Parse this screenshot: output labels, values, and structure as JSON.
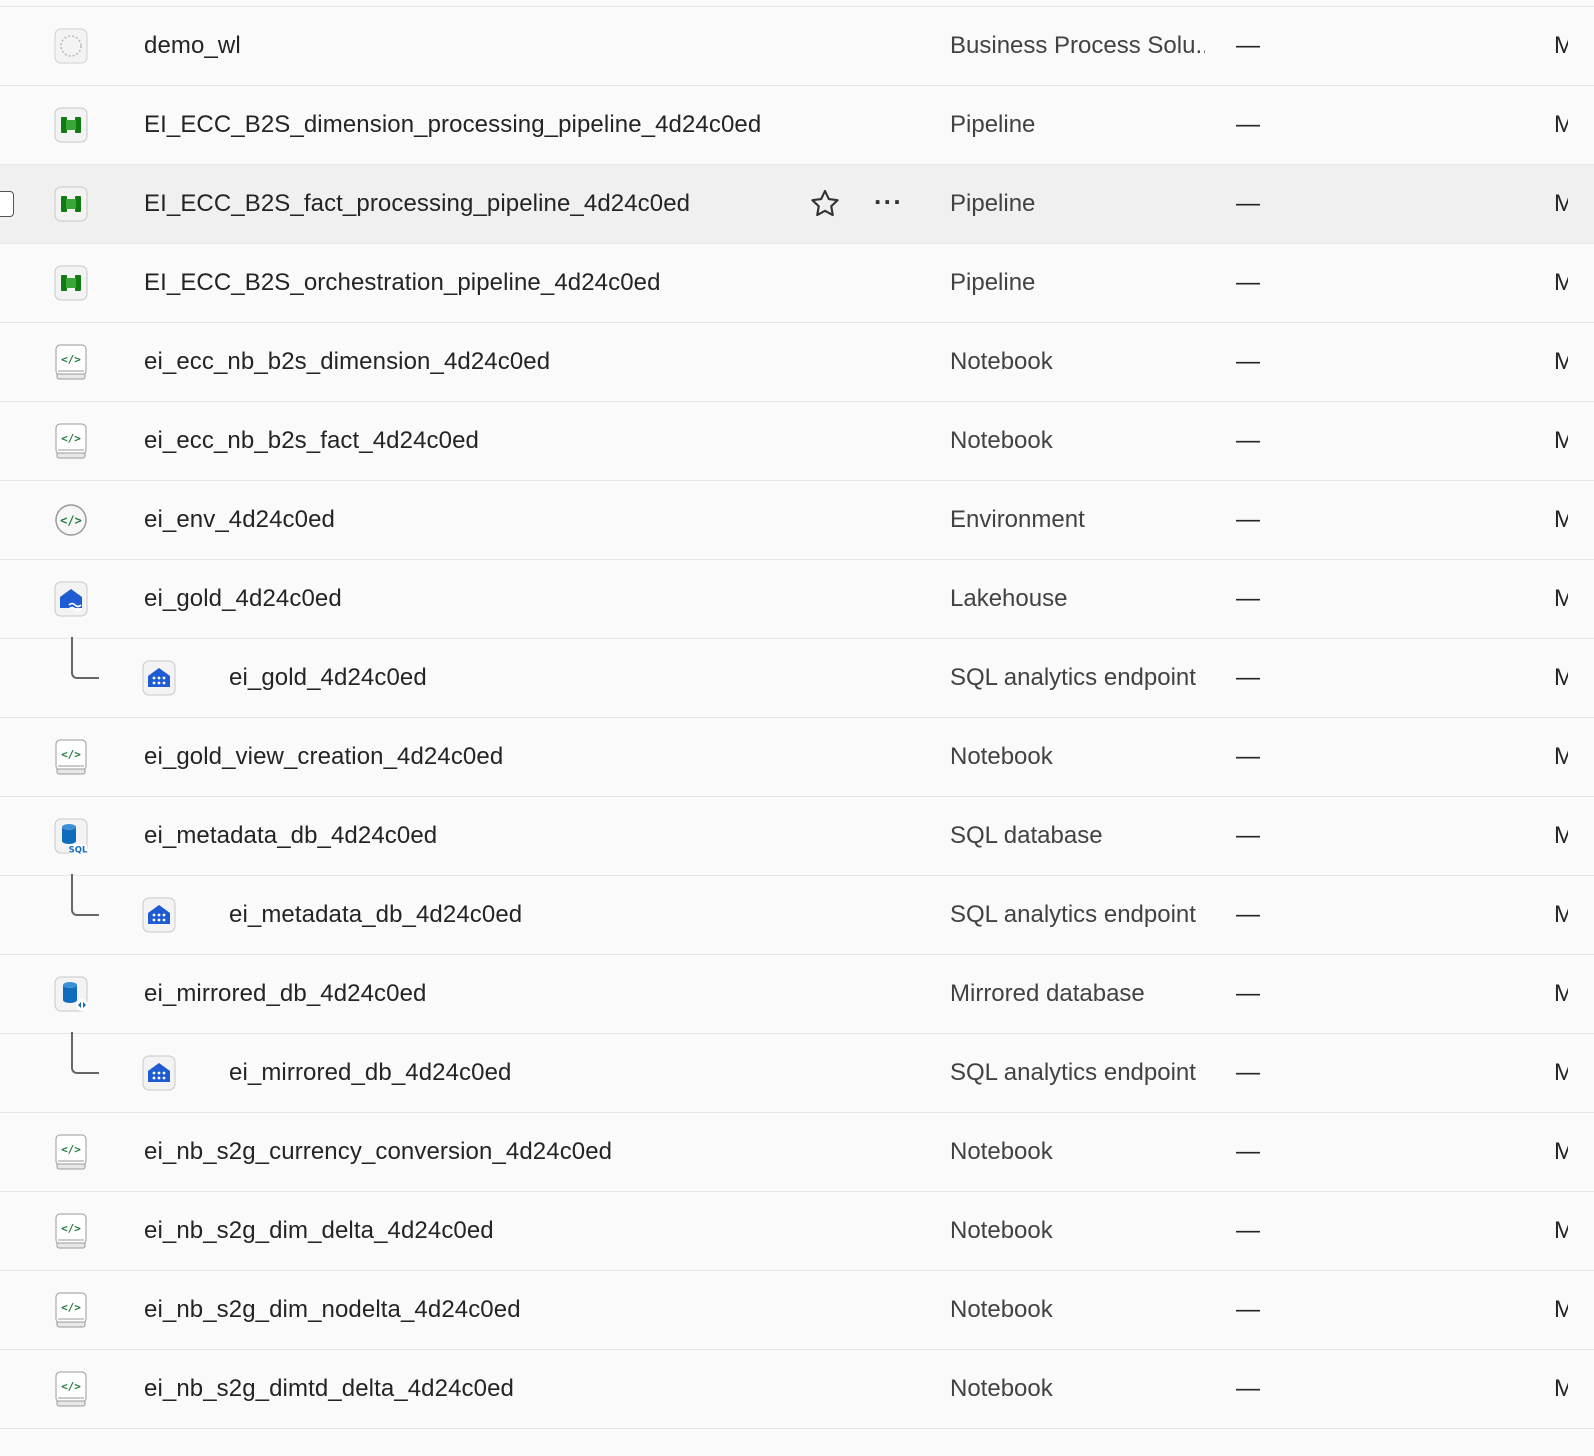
{
  "colors": {
    "pipeline_green": "#107c10",
    "notebook_green": "#1f7a3a",
    "lakehouse_blue": "#1f5bd1",
    "sql_blue": "#0f6cbd",
    "divider": "#e6e6e6",
    "hover_row": "#f0f0f0"
  },
  "hover_actions": {
    "favorite_icon": "star-icon",
    "more_label": "···"
  },
  "rows": [
    {
      "name": "demo_wl",
      "type": "Business Process Solu...",
      "owner": "—",
      "trunc": "M",
      "icon": "solution-icon",
      "child": false,
      "hovered": false
    },
    {
      "name": "EI_ECC_B2S_dimension_processing_pipeline_4d24c0ed",
      "type": "Pipeline",
      "owner": "—",
      "trunc": "M",
      "icon": "pipeline-icon",
      "child": false,
      "hovered": false
    },
    {
      "name": "EI_ECC_B2S_fact_processing_pipeline_4d24c0ed",
      "type": "Pipeline",
      "owner": "—",
      "trunc": "M",
      "icon": "pipeline-icon",
      "child": false,
      "hovered": true
    },
    {
      "name": "EI_ECC_B2S_orchestration_pipeline_4d24c0ed",
      "type": "Pipeline",
      "owner": "—",
      "trunc": "M",
      "icon": "pipeline-icon",
      "child": false,
      "hovered": false
    },
    {
      "name": "ei_ecc_nb_b2s_dimension_4d24c0ed",
      "type": "Notebook",
      "owner": "—",
      "trunc": "M",
      "icon": "notebook-icon",
      "child": false,
      "hovered": false
    },
    {
      "name": "ei_ecc_nb_b2s_fact_4d24c0ed",
      "type": "Notebook",
      "owner": "—",
      "trunc": "M",
      "icon": "notebook-icon",
      "child": false,
      "hovered": false
    },
    {
      "name": "ei_env_4d24c0ed",
      "type": "Environment",
      "owner": "—",
      "trunc": "M",
      "icon": "environment-icon",
      "child": false,
      "hovered": false
    },
    {
      "name": "ei_gold_4d24c0ed",
      "type": "Lakehouse",
      "owner": "—",
      "trunc": "M",
      "icon": "lakehouse-icon",
      "child": false,
      "hovered": false
    },
    {
      "name": "ei_gold_4d24c0ed",
      "type": "SQL analytics endpoint",
      "owner": "—",
      "trunc": "M",
      "icon": "sql-endpoint-icon",
      "child": true,
      "hovered": false
    },
    {
      "name": "ei_gold_view_creation_4d24c0ed",
      "type": "Notebook",
      "owner": "—",
      "trunc": "M",
      "icon": "notebook-icon",
      "child": false,
      "hovered": false
    },
    {
      "name": "ei_metadata_db_4d24c0ed",
      "type": "SQL database",
      "owner": "—",
      "trunc": "M",
      "icon": "sql-database-icon",
      "child": false,
      "hovered": false
    },
    {
      "name": "ei_metadata_db_4d24c0ed",
      "type": "SQL analytics endpoint",
      "owner": "—",
      "trunc": "M",
      "icon": "sql-endpoint-icon",
      "child": true,
      "hovered": false
    },
    {
      "name": "ei_mirrored_db_4d24c0ed",
      "type": "Mirrored database",
      "owner": "—",
      "trunc": "M",
      "icon": "mirrored-database-icon",
      "child": false,
      "hovered": false
    },
    {
      "name": "ei_mirrored_db_4d24c0ed",
      "type": "SQL analytics endpoint",
      "owner": "—",
      "trunc": "M",
      "icon": "sql-endpoint-icon",
      "child": true,
      "hovered": false
    },
    {
      "name": "ei_nb_s2g_currency_conversion_4d24c0ed",
      "type": "Notebook",
      "owner": "—",
      "trunc": "M",
      "icon": "notebook-icon",
      "child": false,
      "hovered": false
    },
    {
      "name": "ei_nb_s2g_dim_delta_4d24c0ed",
      "type": "Notebook",
      "owner": "—",
      "trunc": "M",
      "icon": "notebook-icon",
      "child": false,
      "hovered": false
    },
    {
      "name": "ei_nb_s2g_dim_nodelta_4d24c0ed",
      "type": "Notebook",
      "owner": "—",
      "trunc": "M",
      "icon": "notebook-icon",
      "child": false,
      "hovered": false
    },
    {
      "name": "ei_nb_s2g_dimtd_delta_4d24c0ed",
      "type": "Notebook",
      "owner": "—",
      "trunc": "M",
      "icon": "notebook-icon",
      "child": false,
      "hovered": false
    }
  ]
}
